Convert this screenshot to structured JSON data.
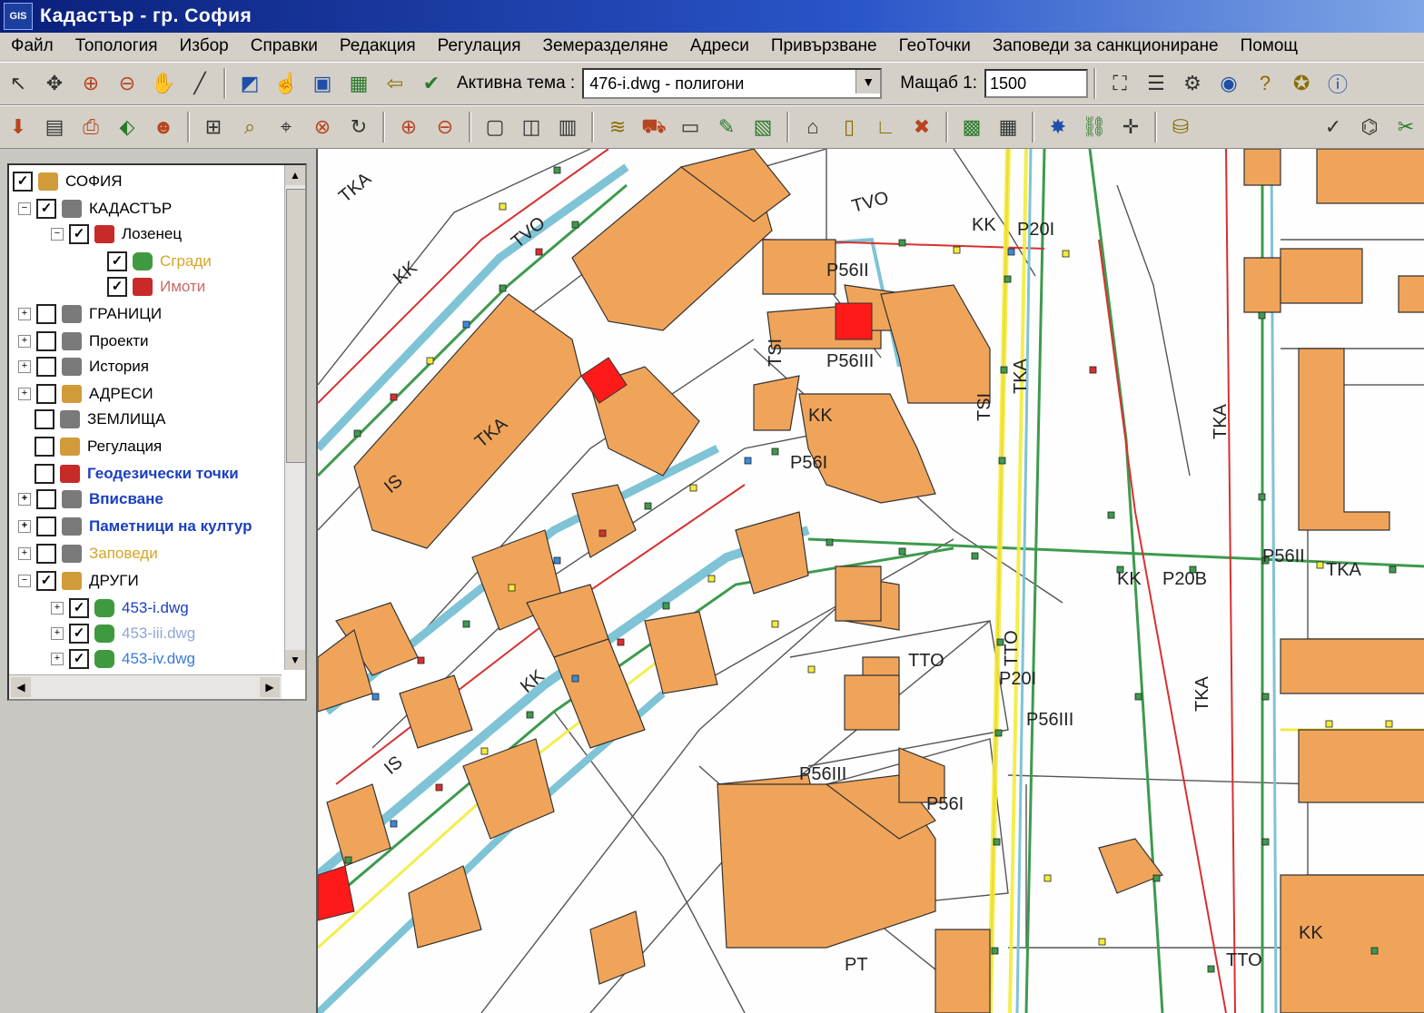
{
  "window": {
    "title": "Кадастър - гр. София",
    "logo": "GIS"
  },
  "menu": [
    "Файл",
    "Топология",
    "Избор",
    "Справки",
    "Редакция",
    "Регулация",
    "Земеразделяне",
    "Адреси",
    "Привързване",
    "ГеоТочки",
    "Заповеди за санкциониране",
    "Помощ"
  ],
  "toolbar": {
    "active_theme_label": "Активна тема :",
    "active_theme_value": "476-i.dwg - полигони",
    "scale_label": "Мащаб 1:",
    "scale_value": "1500"
  },
  "icons": {
    "theme_dropdown": "chevron-down-icon",
    "layer": "layer-icon"
  },
  "tree": {
    "root": "СОФИЯ",
    "items": [
      {
        "label": "КАДАСТЪР",
        "color": "#000000"
      },
      {
        "label": "Лозенец",
        "color": "#000000"
      },
      {
        "label": "Сгради",
        "color": "#d6a52a"
      },
      {
        "label": "Имоти",
        "color": "#c86a6a"
      },
      {
        "label": "ГРАНИЦИ",
        "color": "#000000"
      },
      {
        "label": "Проекти",
        "color": "#000000"
      },
      {
        "label": "История",
        "color": "#000000"
      },
      {
        "label": "АДРЕСИ",
        "color": "#000000"
      },
      {
        "label": "ЗЕМЛИЩА",
        "color": "#000000"
      },
      {
        "label": "Регулация",
        "color": "#000000"
      },
      {
        "label": "Геодезически точки",
        "color": "#1a3fc0"
      },
      {
        "label": "Вписване",
        "color": "#1a3fc0"
      },
      {
        "label": "Паметници на култур",
        "color": "#1a3fc0"
      },
      {
        "label": "Заповеди",
        "color": "#d6a52a"
      },
      {
        "label": "ДРУГИ",
        "color": "#000000"
      },
      {
        "label": "453-i.dwg",
        "color": "#1a3fc0"
      },
      {
        "label": "453-iii.dwg",
        "color": "#8fa6d8"
      },
      {
        "label": "453-iv.dwg",
        "color": "#3a7ad8"
      }
    ]
  },
  "map": {
    "colors": {
      "building": "#f0a45a",
      "highlight": "#ff1a1a",
      "parcel_line": "#555555",
      "utility_cyan": "#7fc3d6",
      "utility_green": "#3e9a4e",
      "utility_red": "#d83030",
      "utility_yellow": "#f2ec3a"
    },
    "labels": [
      "TKA",
      "TKA",
      "TVO",
      "TVO",
      "KK",
      "KK",
      "KK",
      "KK",
      "KK",
      "IS",
      "IS",
      "TSI",
      "TSI",
      "P56II",
      "P56III",
      "P56III",
      "P56III",
      "P56I",
      "P56I",
      "P20I",
      "P20I",
      "P20B",
      "TKA",
      "TTO",
      "TTO",
      "TTO",
      "TKA",
      "TKA",
      "PT",
      "KK",
      "TKA",
      "P56II"
    ]
  }
}
